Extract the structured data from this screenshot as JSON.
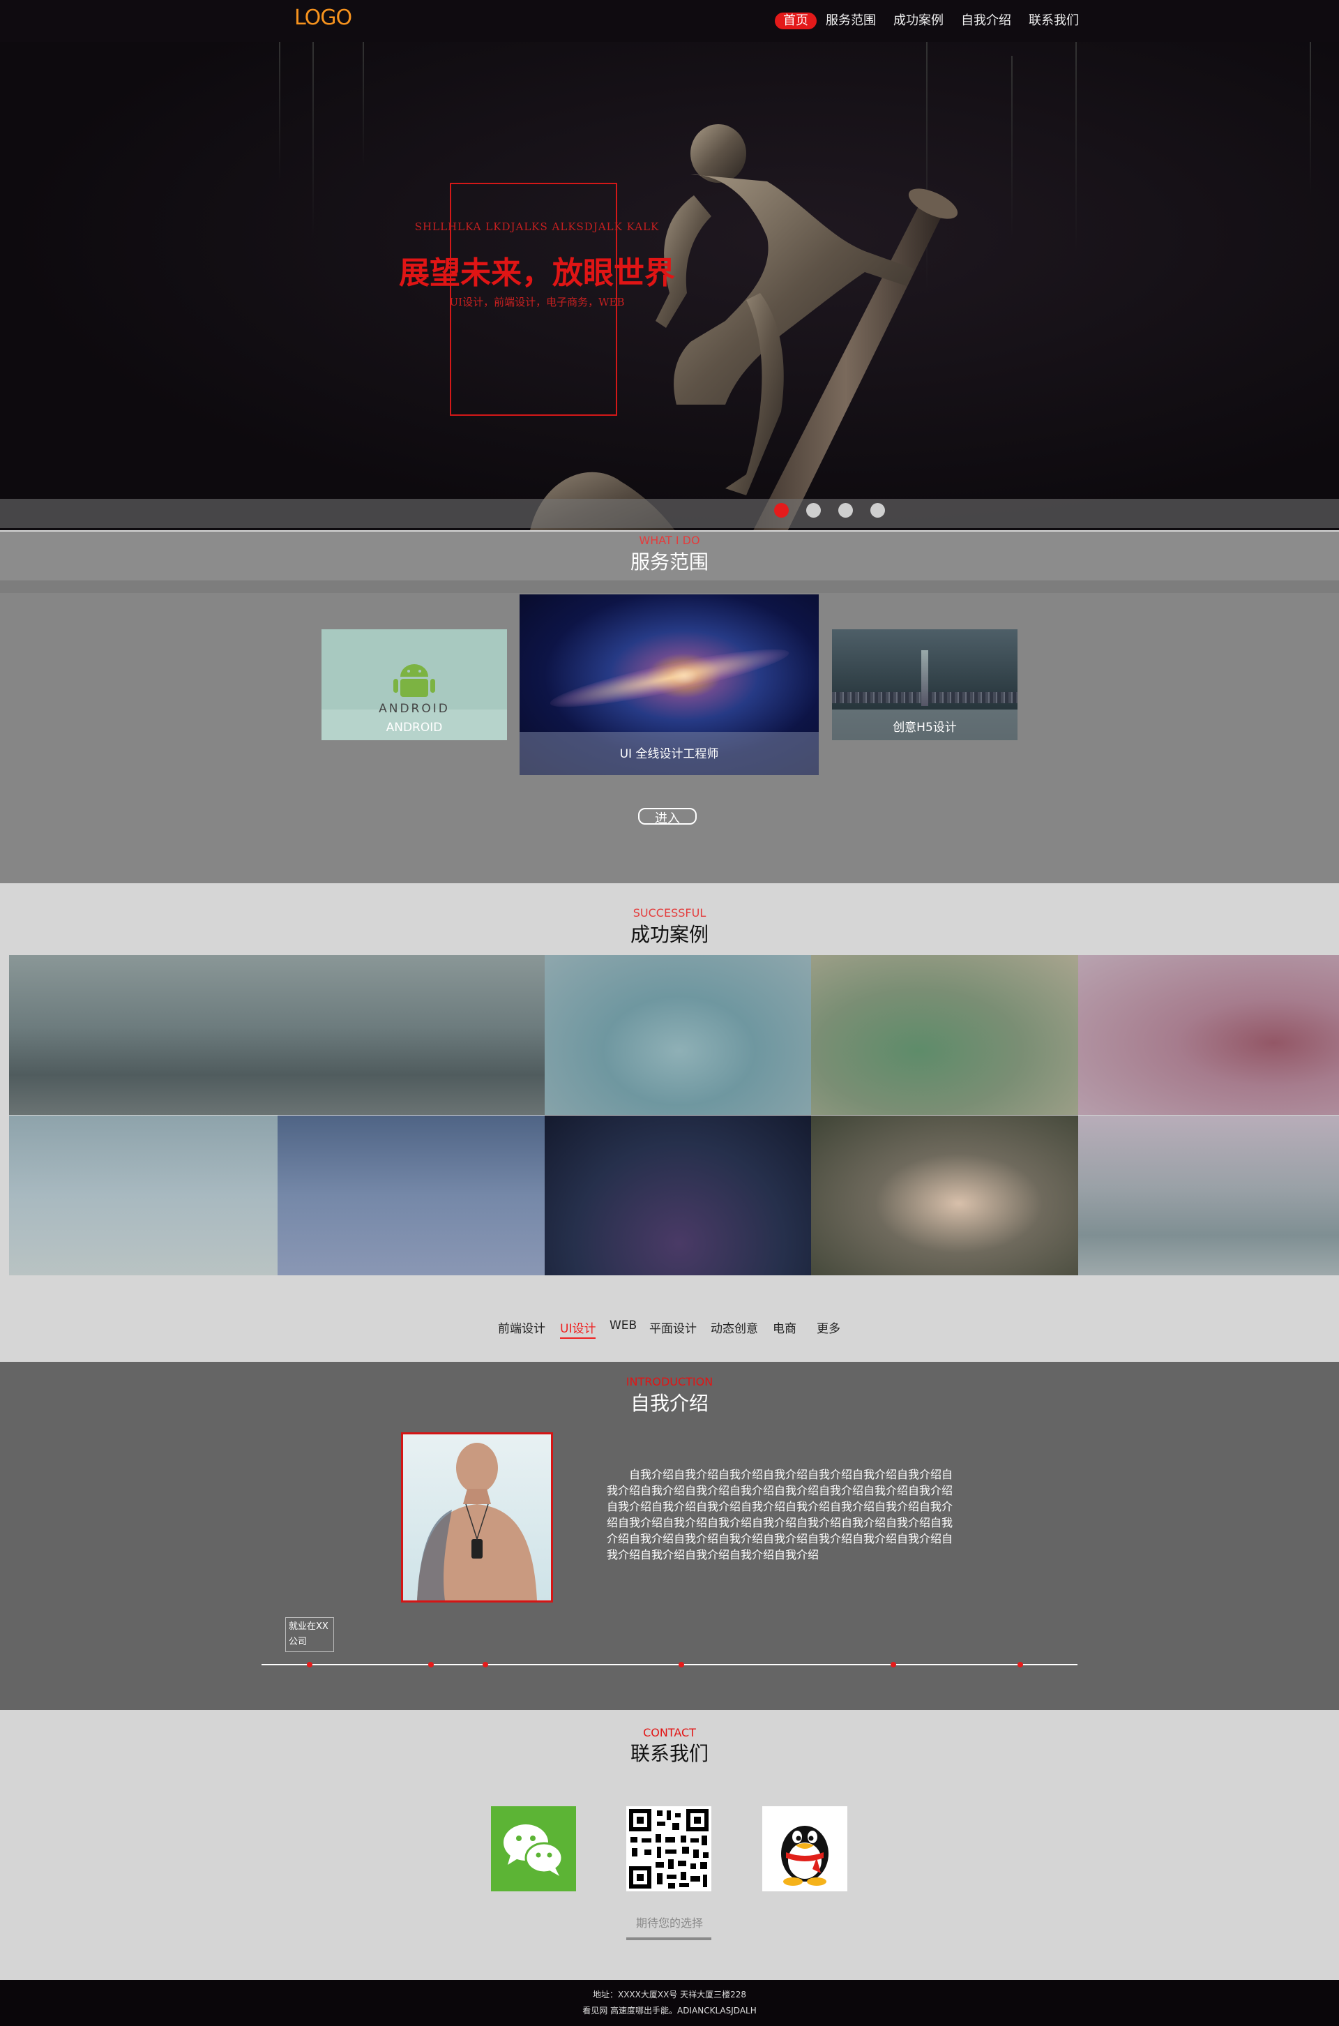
{
  "header": {
    "logo": "LOGO",
    "nav": [
      "首页",
      "服务范围",
      "成功案例",
      "自我介绍",
      "联系我们"
    ]
  },
  "hero": {
    "subtitle": "SHLLHLKA LKDJALKS ALKSDJALK KALK",
    "title": "展望未来，放眼世界",
    "tags": "UI设计，前端设计，电子商务，WEB",
    "slide_count": 4,
    "active_slide": 1
  },
  "services": {
    "en": "WHAT I DO",
    "cn": "服务范围",
    "cards": [
      "ANDROID",
      "UI 全线设计工程师",
      "创意H5设计"
    ],
    "android_logo_text": "ANDROID",
    "enter": "进入"
  },
  "cases": {
    "en": "SUCCESSFUL",
    "cn": "成功案例",
    "filters": [
      "前端设计",
      "UI设计",
      "WEB",
      "平面设计",
      "动态创意",
      "电商",
      "更多"
    ],
    "active_filter": "UI设计"
  },
  "about": {
    "en": "INTRODUCTION",
    "cn": "自我介绍",
    "intro": "自我介绍自我介绍自我介绍自我介绍自我介绍自我介绍自我介绍自我介绍自我介绍自我介绍自我介绍自我介绍自我介绍自我介绍自我介绍自我介绍自我介绍自我介绍自我介绍自我介绍自我介绍自我介绍自我介绍自我介绍自我介绍自我介绍自我介绍自我介绍自我介绍自我介绍自我介绍自我介绍自我介绍自我介绍自我介绍自我介绍自我介绍自我介绍自我介绍自我介绍自我介绍自我介绍自我介绍",
    "timeline_label": "就业在XX公司"
  },
  "contact": {
    "en": "CONTACT",
    "cn": "联系我们",
    "name": "期待您的选择"
  },
  "footer": {
    "address": "地址：XXXX大厦XX号 天祥大厦三楼228",
    "line2": "看见网 高速度哪出手能。ADIANCKLASJDALH"
  },
  "colors": {
    "accent": "#e31a1a",
    "logo": "#f7931e"
  }
}
